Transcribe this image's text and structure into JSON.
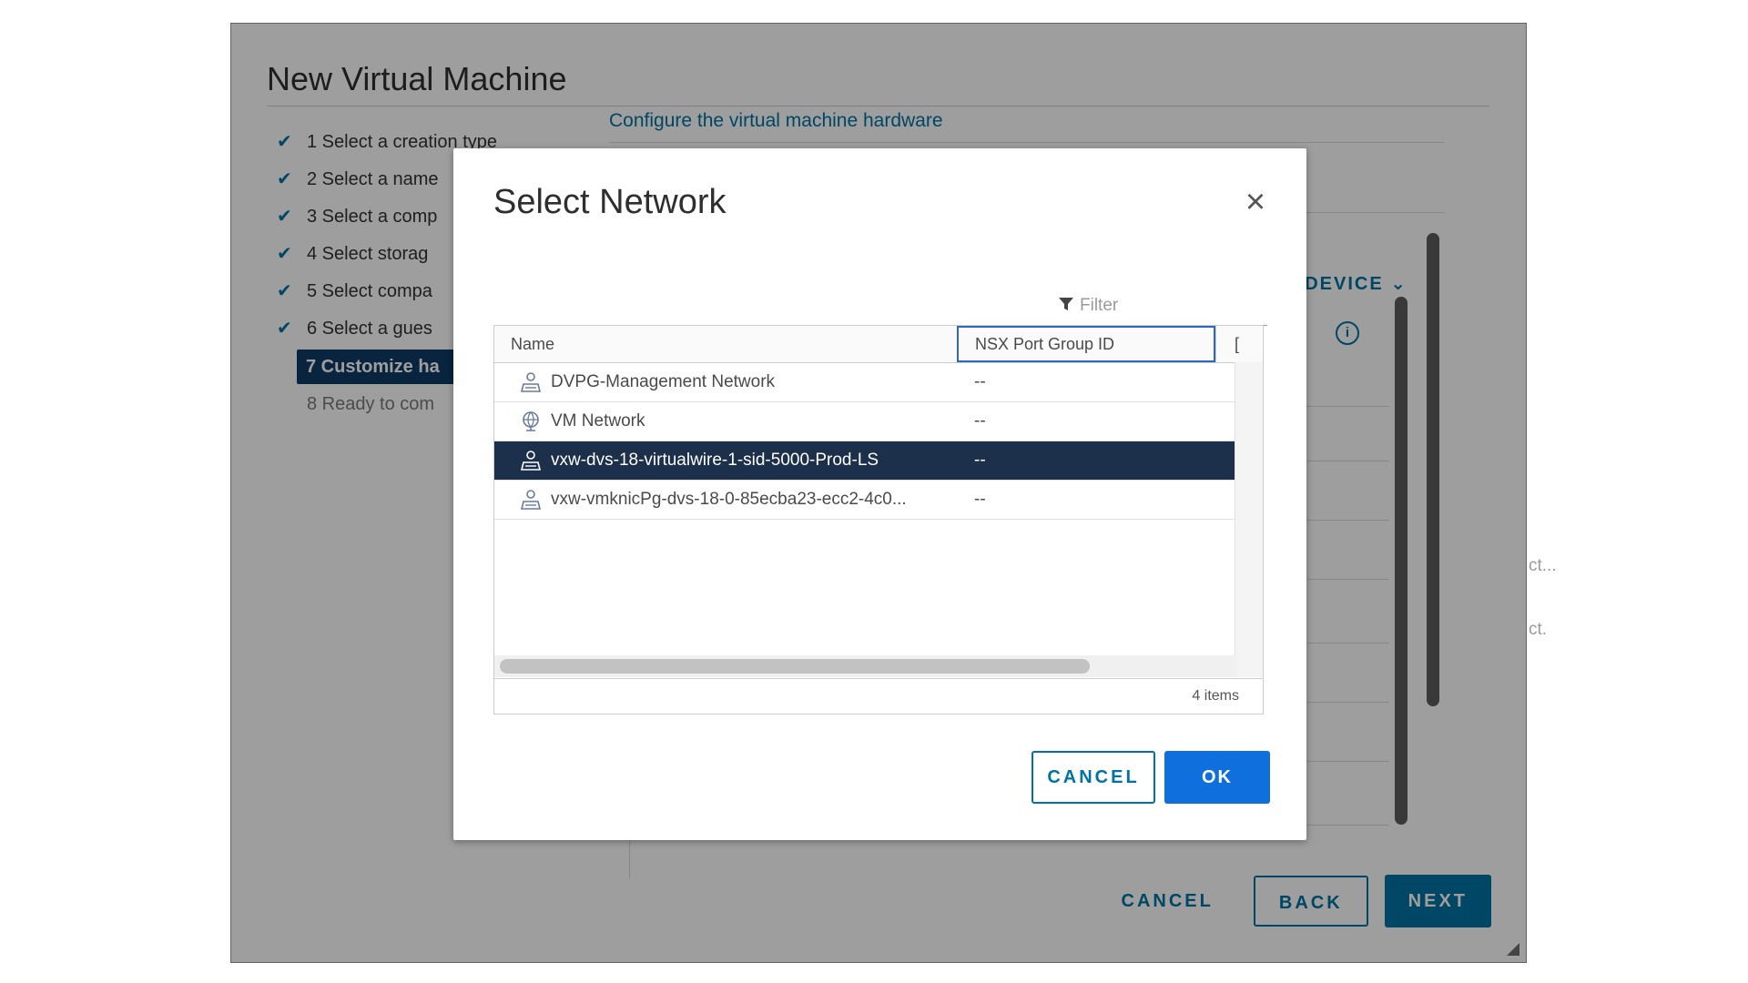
{
  "wizard": {
    "title": "New Virtual Machine",
    "steps": [
      {
        "label": "1 Select a creation type",
        "state": "done"
      },
      {
        "label": "2 Select a name",
        "state": "done"
      },
      {
        "label": "3 Select a comp",
        "state": "done"
      },
      {
        "label": "4 Select storag",
        "state": "done"
      },
      {
        "label": "5 Select compa",
        "state": "done"
      },
      {
        "label": "6 Select a gues",
        "state": "done"
      },
      {
        "label": "7 Customize ha",
        "state": "active"
      },
      {
        "label": "8 Ready to com",
        "state": "pending"
      }
    ],
    "main_subtitle": "Configure the virtual machine hardware",
    "add_device_label": "W DEVICE",
    "faded_1": "ct...",
    "faded_2": "ct.",
    "footer": {
      "cancel_label": "CANCEL",
      "back_label": "BACK",
      "next_label": "NEXT"
    }
  },
  "dialog": {
    "title": "Select Network",
    "filter_placeholder": "Filter",
    "columns": {
      "name": "Name",
      "nsx_port_group_id": "NSX Port Group ID",
      "extra": "["
    },
    "rows": [
      {
        "name": "DVPG-Management Network",
        "nsx_id": "--",
        "icon": "port-group-icon",
        "selected": false
      },
      {
        "name": "VM Network",
        "nsx_id": "--",
        "icon": "network-globe-icon",
        "selected": false
      },
      {
        "name": "vxw-dvs-18-virtualwire-1-sid-5000-Prod-LS",
        "nsx_id": "--",
        "icon": "port-group-icon",
        "selected": true
      },
      {
        "name": "vxw-vmknicPg-dvs-18-0-85ecba23-ecc2-4c0...",
        "nsx_id": "--",
        "icon": "port-group-icon",
        "selected": false
      }
    ],
    "item_count": "4 items",
    "cancel_label": "CANCEL",
    "ok_label": "OK"
  },
  "colors": {
    "accent": "#0072a3",
    "ok_button": "#0f6fdc",
    "selected_row": "#1c2f4b",
    "active_step": "#0d3b66"
  }
}
